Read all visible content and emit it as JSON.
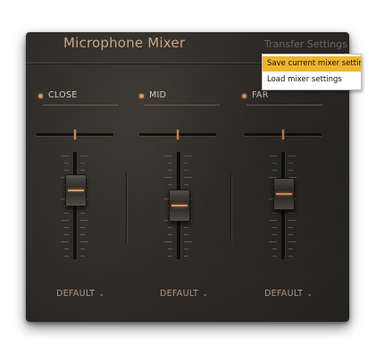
{
  "window": {
    "title": "Microphone Mixer"
  },
  "transfer_menu": {
    "label": "Transfer Settings",
    "items": [
      {
        "label": "Save current mixer settings",
        "highlighted": true
      },
      {
        "label": "Load mixer settings",
        "highlighted": false
      }
    ]
  },
  "channels": [
    {
      "name": "CLOSE",
      "preset": "DEFAULT",
      "fader_level": 0.7,
      "pan": 0.5
    },
    {
      "name": "MID",
      "preset": "DEFAULT",
      "fader_level": 0.5,
      "pan": 0.5
    },
    {
      "name": "FAR",
      "preset": "DEFAULT",
      "fader_level": 0.65,
      "pan": 0.5
    }
  ],
  "colors": {
    "accent": "#d89466",
    "highlight": "#f0b52c",
    "panel": "#2e2b27"
  },
  "icons": {
    "preset_dropdown": "chevron-down-icon",
    "channel_indicator": "led-dot-icon"
  }
}
